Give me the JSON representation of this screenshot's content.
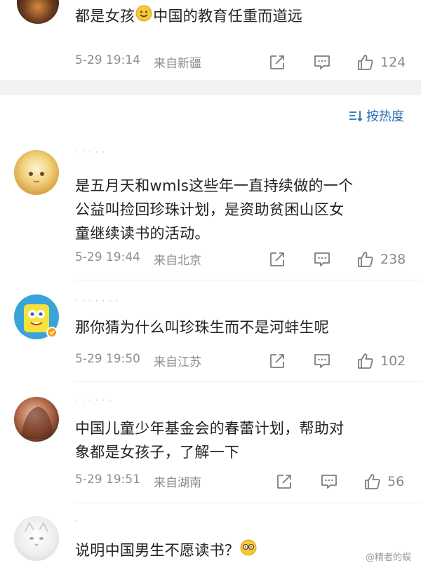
{
  "top_comment": {
    "text_before": "都是女孩",
    "text_after": "中国的教育任重而道远",
    "time": "5-29 19:14",
    "location": "来自新疆",
    "likes": "124"
  },
  "sort": {
    "label": "按热度"
  },
  "comments": [
    {
      "username": "· · · · ·",
      "lines": [
        "是五月天和wmls这些年一直持续做的一个",
        "公益叫捡回珍珠计划，是资助贫困山区女",
        "童继续读书的活动。"
      ],
      "time": "5-29 19:44",
      "location": "来自北京",
      "likes": "238"
    },
    {
      "username": "· · · · · · ·",
      "lines": [
        "那你猜为什么叫珍珠生而不是河蚌生呢"
      ],
      "time": "5-29 19:50",
      "location": "来自江苏",
      "likes": "102"
    },
    {
      "username": "· · · · · ·",
      "lines": [
        "中国儿童少年基金会的春蕾计划，帮助对",
        "象都是女孩子，了解一下"
      ],
      "time": "5-29 19:51",
      "location": "来自湖南",
      "likes": "56"
    },
    {
      "username": "·",
      "lines": [
        "说明中国男生不愿读书？"
      ],
      "time": "",
      "location": "",
      "likes": ""
    }
  ],
  "watermark": "@精者的蜈"
}
